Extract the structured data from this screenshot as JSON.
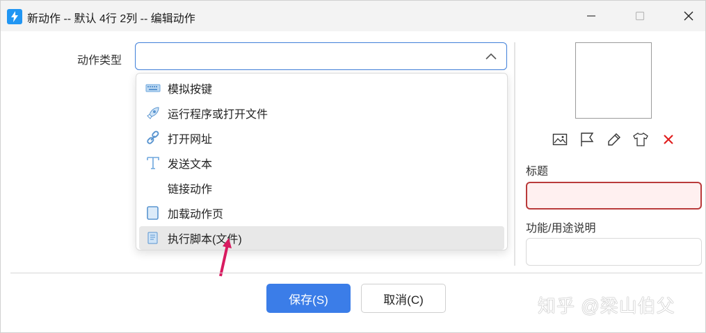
{
  "window": {
    "title": "新动作 -- 默认 4行 2列 -- 编辑动作",
    "controls": [
      "minimize-icon",
      "maximize-icon",
      "close-icon"
    ]
  },
  "form": {
    "action_type_label": "动作类型",
    "action_type_value": "",
    "title_label": "标题",
    "title_value": "",
    "desc_label": "功能/用途说明",
    "desc_value": ""
  },
  "dropdown": {
    "options": [
      {
        "label": "模拟按键",
        "icon": "keyboard-icon"
      },
      {
        "label": "运行程序或打开文件",
        "icon": "rocket-icon"
      },
      {
        "label": "打开网址",
        "icon": "link-icon"
      },
      {
        "label": "发送文本",
        "icon": "text-t-icon"
      },
      {
        "label": "链接动作",
        "icon": ""
      },
      {
        "label": "加载动作页",
        "icon": "page-icon"
      },
      {
        "label": "执行脚本(文件)",
        "icon": "script-icon"
      }
    ],
    "highlighted_index": 6
  },
  "toolbar_icons": [
    "image-icon",
    "flag-icon",
    "eyedropper-icon",
    "shirt-icon",
    "delete-x-icon"
  ],
  "buttons": {
    "save": "保存(S)",
    "cancel": "取消(C)"
  },
  "watermark": "知乎 @梁山伯父",
  "colors": {
    "accent": "#3b7de8",
    "error_border": "#b93a3a",
    "annotation_arrow": "#d81b60"
  }
}
